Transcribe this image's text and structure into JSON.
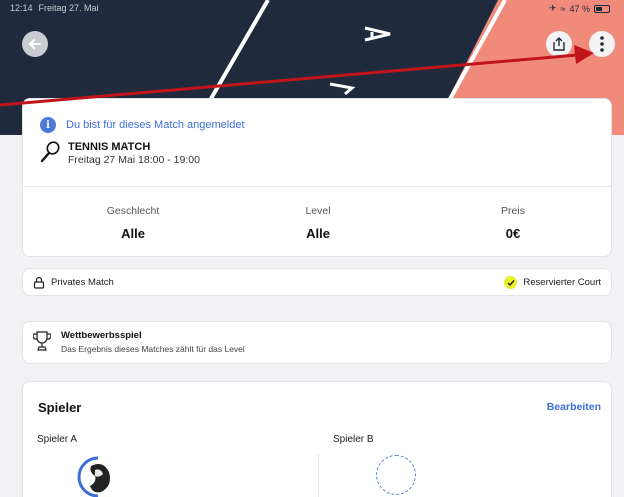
{
  "status_bar": {
    "time": "12:14",
    "date": "Freitag 27. Mai",
    "battery": "47 %",
    "battery_level": 0.47
  },
  "header": {
    "back_icon": "arrow-left-icon",
    "share_icon": "share-icon",
    "more_icon": "more-vertical-icon",
    "colors": {
      "dark": "#1f2b3c",
      "accent": "#f08a7b"
    }
  },
  "notice": {
    "text": "Du bist für dieses Match angemeldet",
    "color": "#3e6fd8"
  },
  "match": {
    "title": "TENNIS MATCH",
    "time": "Freitag 27 Mai 18:00 - 19:00",
    "stats": [
      {
        "label": "Geschlecht",
        "value": "Alle"
      },
      {
        "label": "Level",
        "value": "Alle"
      },
      {
        "label": "Preis",
        "value": "0€"
      }
    ]
  },
  "privacy": {
    "label": "Privates Match",
    "court": "Reservierter Court",
    "check_color": "#e7ee2c"
  },
  "competition": {
    "title": "Wettbewerbsspiel",
    "subtitle": "Das Ergebnis dieses Matches zählt für das Level"
  },
  "players": {
    "title": "Spieler",
    "edit": "Bearbeiten",
    "slot_a": "Spieler A",
    "slot_b": "Spieler B"
  }
}
